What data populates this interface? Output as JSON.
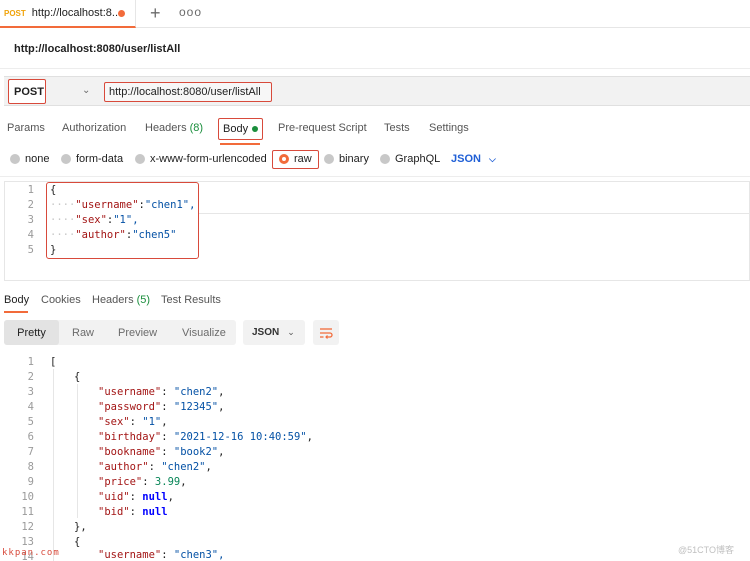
{
  "tabbar": {
    "tab_method": "POST",
    "tab_title": "http://localhost:8...",
    "plus": "+",
    "more": "ooo"
  },
  "request": {
    "name": "http://localhost:8080/user/listAll",
    "method": "POST",
    "url": "http://localhost:8080/user/listAll"
  },
  "request_tabs": {
    "params": "Params",
    "authorization": "Authorization",
    "headers": "Headers",
    "headers_count": "(8)",
    "body": "Body",
    "prerequest": "Pre-request Script",
    "tests": "Tests",
    "settings": "Settings"
  },
  "body_types": {
    "none": "none",
    "form_data": "form-data",
    "urlencoded": "x-www-form-urlencoded",
    "raw": "raw",
    "binary": "binary",
    "graphql": "GraphQL",
    "language": "JSON"
  },
  "request_body": {
    "line_numbers": [
      "1",
      "2",
      "3",
      "4",
      "5"
    ],
    "open_brace": "{",
    "fields": [
      {
        "key": "\"username\"",
        "value": "\"chen1\","
      },
      {
        "key": "\"sex\"",
        "value": "\"1\","
      },
      {
        "key": "\"author\"",
        "value": "\"chen5\""
      }
    ],
    "close_brace": "}"
  },
  "response_tabs": {
    "body": "Body",
    "cookies": "Cookies",
    "headers": "Headers",
    "headers_count": "(5)",
    "test_results": "Test Results"
  },
  "response_toolbar": {
    "pretty": "Pretty",
    "raw": "Raw",
    "preview": "Preview",
    "visualize": "Visualize",
    "format": "JSON"
  },
  "response_body": {
    "line_numbers": [
      "1",
      "2",
      "3",
      "4",
      "5",
      "6",
      "7",
      "8",
      "9",
      "10",
      "11",
      "12",
      "13",
      "14"
    ],
    "l1": "[",
    "l2": "{",
    "l3_key": "\"username\"",
    "l3_val": "\"chen2\"",
    "l4_key": "\"password\"",
    "l4_val": "\"12345\"",
    "l5_key": "\"sex\"",
    "l5_val": "\"1\"",
    "l6_key": "\"birthday\"",
    "l6_val": "\"2021-12-16 10:40:59\"",
    "l7_key": "\"bookname\"",
    "l7_val": "\"book2\"",
    "l8_key": "\"author\"",
    "l8_val": "\"chen2\"",
    "l9_key": "\"price\"",
    "l9_val": "3.99",
    "l10_key": "\"uid\"",
    "l10_val": "null",
    "l11_key": "\"bid\"",
    "l11_val": "null",
    "l12": "},",
    "l13": "{",
    "l14_key": "\"username\"",
    "l14_val": "\"chen3\","
  },
  "watermark": {
    "left": "kkpan.com",
    "right": "@51CTO博客"
  }
}
